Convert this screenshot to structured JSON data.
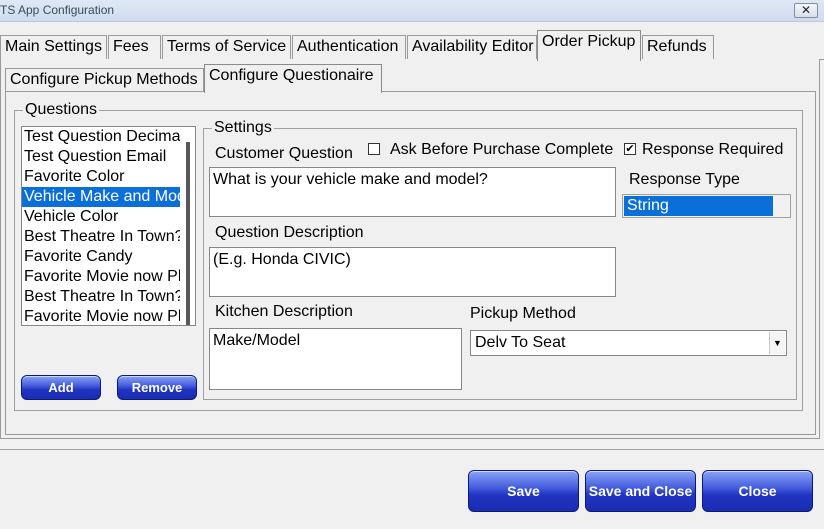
{
  "window": {
    "title": "TS App Configuration",
    "close_glyph": "✕"
  },
  "main_tabs": [
    {
      "label": "Main Settings"
    },
    {
      "label": "Fees"
    },
    {
      "label": "Terms of Service"
    },
    {
      "label": "Authentication"
    },
    {
      "label": "Availability Editor"
    },
    {
      "label": "Order Pickup"
    },
    {
      "label": "Refunds"
    }
  ],
  "sub_tabs": [
    {
      "label": "Configure Pickup Methods"
    },
    {
      "label": "Configure Questionaire"
    }
  ],
  "questions": {
    "legend": "Questions",
    "items": [
      "Test Question Decimal",
      "Test Question Email",
      "Favorite Color",
      "Vehicle Make and Model",
      "Vehicle Color",
      "Best Theatre In Town?",
      "Favorite Candy",
      "Favorite Movie now Playing",
      "Best Theatre In Town?",
      "Favorite Movie now Playing"
    ],
    "add_label": "Add",
    "remove_label": "Remove"
  },
  "settings": {
    "legend": "Settings",
    "customer_question_label": "Customer Question",
    "ask_before_label": "Ask Before Purchase Complete",
    "ask_before_checked": "",
    "response_required_label": "Response Required",
    "response_required_checked": "✔",
    "customer_question_value": "What is your vehicle make and model?",
    "response_type_label": "Response Type",
    "response_type_value": "String",
    "question_description_label": "Question Description",
    "question_description_value": "(E.g. Honda CIVIC)",
    "kitchen_description_label": "Kitchen Description",
    "kitchen_description_value": "Make/Model",
    "pickup_method_label": "Pickup Method",
    "pickup_method_value": "Delv To Seat",
    "dropdown_glyph": "▼"
  },
  "footer": {
    "save_label": "Save",
    "save_close_label": "Save and Close",
    "close_label": "Close"
  },
  "colors": {
    "selection": "#0a6fd8",
    "button_blue": "#2134c2"
  }
}
